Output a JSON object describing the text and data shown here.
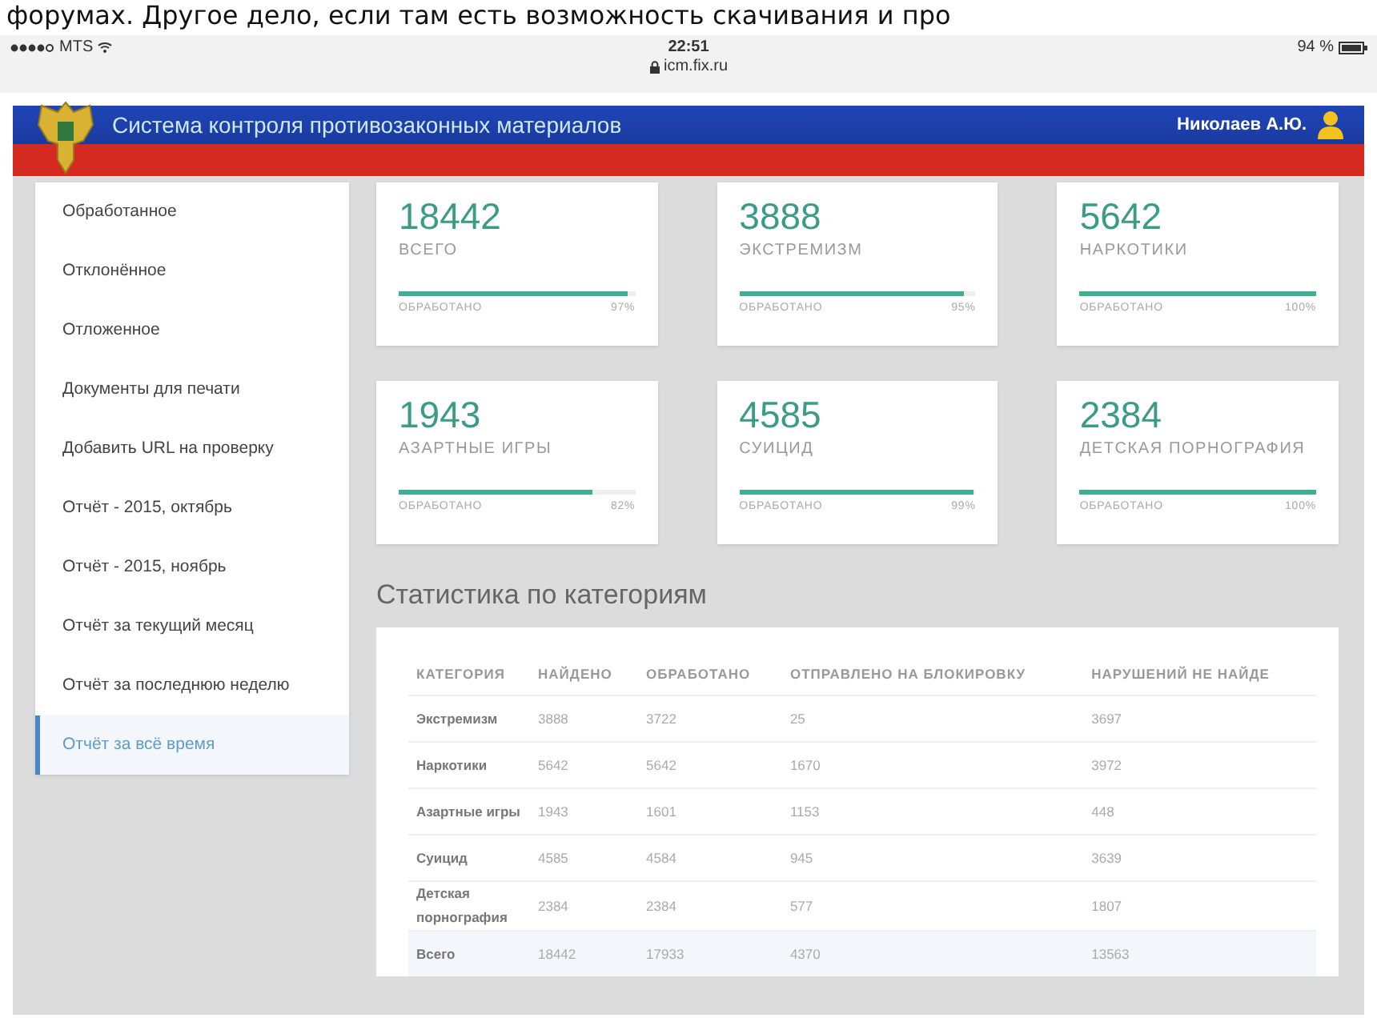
{
  "article_snippet": "форумах. Другое дело, если там есть возможность скачивания и про",
  "status_bar": {
    "carrier": "MTS",
    "time": "22:51",
    "url": "icm.fix.ru",
    "battery": "94 %"
  },
  "header": {
    "title": "Система контроля противозаконных материалов",
    "user": "Николаев А.Ю."
  },
  "sidebar": {
    "items": [
      {
        "label": "Обработанное",
        "selected": false
      },
      {
        "label": "Отклонённое",
        "selected": false
      },
      {
        "label": "Отложенное",
        "selected": false
      },
      {
        "label": "Документы для печати",
        "selected": false
      },
      {
        "label": "Добавить URL на проверку",
        "selected": false
      },
      {
        "label": "Отчёт - 2015, октябрь",
        "selected": false
      },
      {
        "label": "Отчёт - 2015, ноябрь",
        "selected": false
      },
      {
        "label": "Отчёт за текущий месяц",
        "selected": false
      },
      {
        "label": "Отчёт за последнюю неделю",
        "selected": false
      },
      {
        "label": "Отчёт за всё время",
        "selected": true
      }
    ]
  },
  "cards": [
    {
      "value": "18442",
      "label": "ВСЕГО",
      "caption": "ОБРАБОТАНО",
      "percent": "97%",
      "level": 0.97
    },
    {
      "value": "3888",
      "label": "ЭКСТРЕМИЗМ",
      "caption": "ОБРАБОТАНО",
      "percent": "95%",
      "level": 0.95
    },
    {
      "value": "5642",
      "label": "НАРКОТИКИ",
      "caption": "ОБРАБОТАНО",
      "percent": "100%",
      "level": 1
    },
    {
      "value": "1943",
      "label": "АЗАРТНЫЕ ИГРЫ",
      "caption": "ОБРАБОТАНО",
      "percent": "82%",
      "level": 0.82
    },
    {
      "value": "4585",
      "label": "СУИЦИД",
      "caption": "ОБРАБОТАНО",
      "percent": "99%",
      "level": 0.99
    },
    {
      "value": "2384",
      "label": "ДЕТСКАЯ ПОРНОГРАФИЯ",
      "caption": "ОБРАБОТАНО",
      "percent": "100%",
      "level": 1
    }
  ],
  "stats": {
    "title": "Статистика по категориям",
    "columns": [
      "КАТЕГОРИЯ",
      "НАЙДЕНО",
      "ОБРАБОТАНО",
      "ОТПРАВЛЕНО НА БЛОКИРОВКУ",
      "НАРУШЕНИЙ НЕ НАЙДЕ"
    ],
    "rows": [
      {
        "kind": "category",
        "cells": [
          "Экстремизм",
          "3888",
          "3722",
          "25",
          "3697"
        ]
      },
      {
        "kind": "category",
        "cells": [
          "Наркотики",
          "5642",
          "5642",
          "1670",
          "3972"
        ]
      },
      {
        "kind": "category",
        "cells": [
          "Азартные игры",
          "1943",
          "1601",
          "1153",
          "448"
        ]
      },
      {
        "kind": "category",
        "cells": [
          "Суицид",
          "4585",
          "4584",
          "945",
          "3639"
        ]
      },
      {
        "kind": "category",
        "cells": [
          "Детская порнография",
          "2384",
          "2384",
          "577",
          "1807"
        ]
      },
      {
        "kind": "total",
        "cells": [
          "Всего",
          "18442",
          "17933",
          "4370",
          "13563"
        ]
      }
    ]
  }
}
